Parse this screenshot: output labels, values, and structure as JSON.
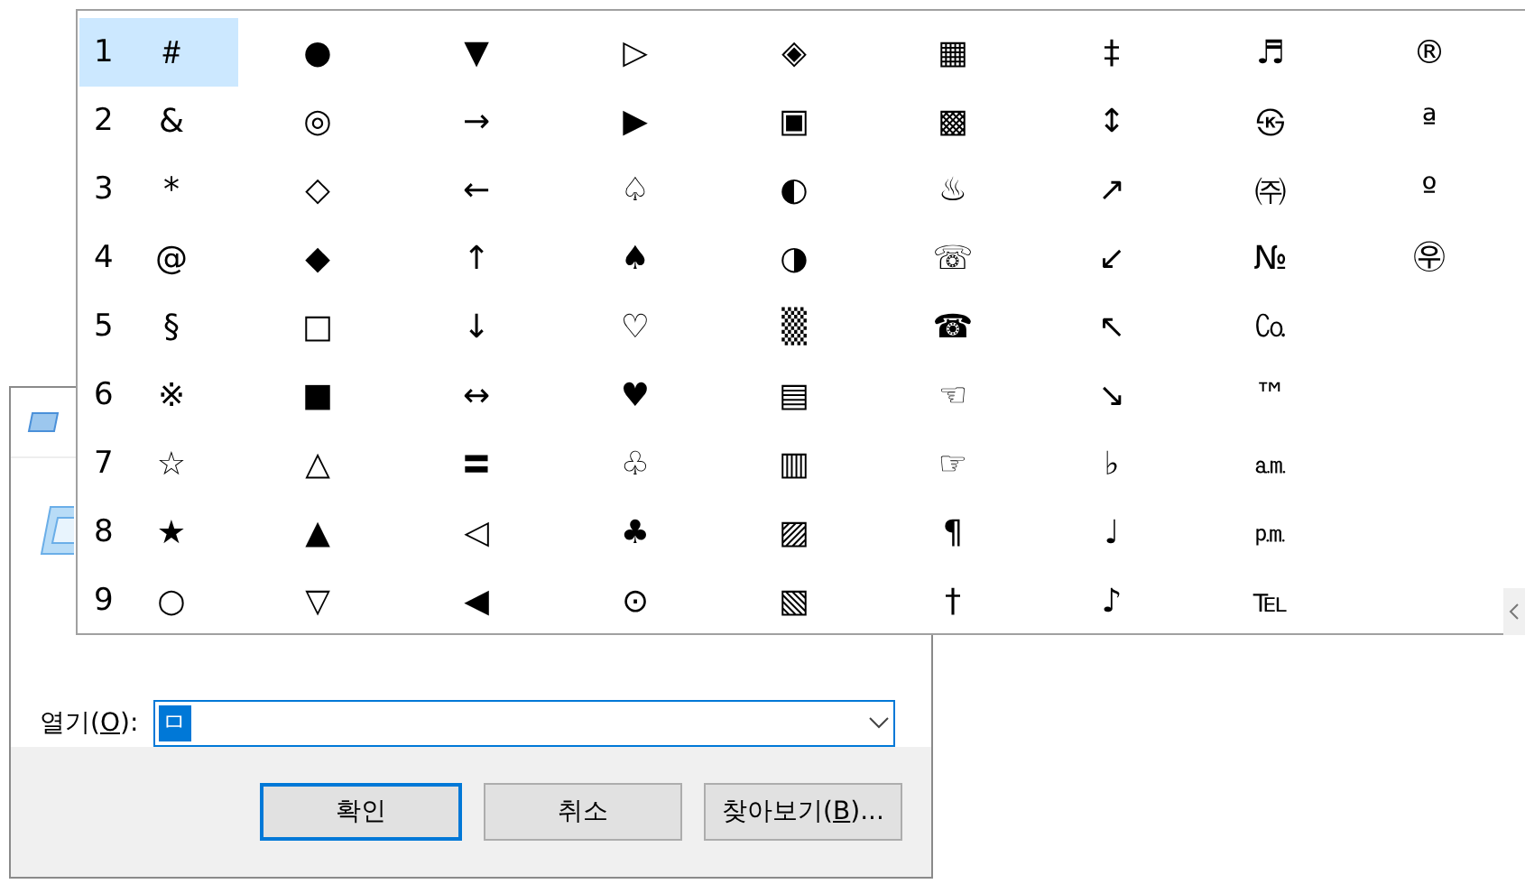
{
  "run_dialog": {
    "open_label": {
      "before": "열기(",
      "mnemonic": "O",
      "after": "):"
    },
    "input_value": "ㅁ",
    "buttons": [
      {
        "label": "확인",
        "default": true
      },
      {
        "label": "취소",
        "default": false
      },
      {
        "label": "찾아보기(",
        "mnemonic": "B",
        "after": ")...",
        "default": false
      }
    ]
  },
  "symbol_picker": {
    "rows": [
      {
        "number": "1",
        "symbols": [
          {
            "char": "＃",
            "selected": true
          },
          {
            "char": "●",
            "selected": false
          },
          {
            "char": "▼",
            "selected": false
          },
          {
            "char": "▷",
            "selected": false
          },
          {
            "char": "◈",
            "selected": false
          },
          {
            "char": "▦",
            "selected": false
          },
          {
            "char": "‡",
            "selected": false
          },
          {
            "char": "♬",
            "selected": false
          },
          {
            "char": "®",
            "selected": false
          }
        ]
      },
      {
        "number": "2",
        "symbols": [
          {
            "char": "&",
            "selected": false
          },
          {
            "char": "◎",
            "selected": false
          },
          {
            "char": "→",
            "selected": false
          },
          {
            "char": "▶",
            "selected": false
          },
          {
            "char": "▣",
            "selected": false
          },
          {
            "char": "▩",
            "selected": false
          },
          {
            "char": "↕",
            "selected": false
          },
          {
            "char": "㉿",
            "selected": false
          },
          {
            "char": "ª",
            "selected": false
          }
        ]
      },
      {
        "number": "3",
        "symbols": [
          {
            "char": "*",
            "selected": false
          },
          {
            "char": "◇",
            "selected": false
          },
          {
            "char": "←",
            "selected": false
          },
          {
            "char": "♤",
            "selected": false
          },
          {
            "char": "◐",
            "selected": false
          },
          {
            "char": "♨",
            "selected": false
          },
          {
            "char": "↗",
            "selected": false
          },
          {
            "char": "㈜",
            "selected": false
          },
          {
            "char": "º",
            "selected": false
          }
        ]
      },
      {
        "number": "4",
        "symbols": [
          {
            "char": "@",
            "selected": false
          },
          {
            "char": "◆",
            "selected": false
          },
          {
            "char": "↑",
            "selected": false
          },
          {
            "char": "♠",
            "selected": false
          },
          {
            "char": "◑",
            "selected": false
          },
          {
            "char": "☏",
            "selected": false
          },
          {
            "char": "↙",
            "selected": false
          },
          {
            "char": "№",
            "selected": false
          },
          {
            "char": "㉾",
            "selected": false
          }
        ]
      },
      {
        "number": "5",
        "symbols": [
          {
            "char": "§",
            "selected": false
          },
          {
            "char": "□",
            "selected": false
          },
          {
            "char": "↓",
            "selected": false
          },
          {
            "char": "♡",
            "selected": false
          },
          {
            "char": "▒",
            "selected": false
          },
          {
            "char": "☎",
            "selected": false
          },
          {
            "char": "↖",
            "selected": false
          },
          {
            "char": "㏇",
            "selected": false
          }
        ]
      },
      {
        "number": "6",
        "symbols": [
          {
            "char": "※",
            "selected": false
          },
          {
            "char": "■",
            "selected": false
          },
          {
            "char": "↔",
            "selected": false
          },
          {
            "char": "♥",
            "selected": false
          },
          {
            "char": "▤",
            "selected": false
          },
          {
            "char": "☜",
            "selected": false
          },
          {
            "char": "↘",
            "selected": false
          },
          {
            "char": "™",
            "selected": false
          }
        ]
      },
      {
        "number": "7",
        "symbols": [
          {
            "char": "☆",
            "selected": false
          },
          {
            "char": "△",
            "selected": false
          },
          {
            "char": "〓",
            "selected": false
          },
          {
            "char": "♧",
            "selected": false
          },
          {
            "char": "▥",
            "selected": false
          },
          {
            "char": "☞",
            "selected": false
          },
          {
            "char": "♭",
            "selected": false
          },
          {
            "char": "㏂",
            "selected": false
          }
        ]
      },
      {
        "number": "8",
        "symbols": [
          {
            "char": "★",
            "selected": false
          },
          {
            "char": "▲",
            "selected": false
          },
          {
            "char": "◁",
            "selected": false
          },
          {
            "char": "♣",
            "selected": false
          },
          {
            "char": "▨",
            "selected": false
          },
          {
            "char": "¶",
            "selected": false
          },
          {
            "char": "♩",
            "selected": false
          },
          {
            "char": "㏘",
            "selected": false
          }
        ]
      },
      {
        "number": "9",
        "symbols": [
          {
            "char": "○",
            "selected": false
          },
          {
            "char": "▽",
            "selected": false
          },
          {
            "char": "◀",
            "selected": false
          },
          {
            "char": "⊙",
            "selected": false
          },
          {
            "char": "▧",
            "selected": false
          },
          {
            "char": "†",
            "selected": false
          },
          {
            "char": "♪",
            "selected": false
          },
          {
            "char": "℡",
            "selected": false
          }
        ]
      }
    ]
  }
}
